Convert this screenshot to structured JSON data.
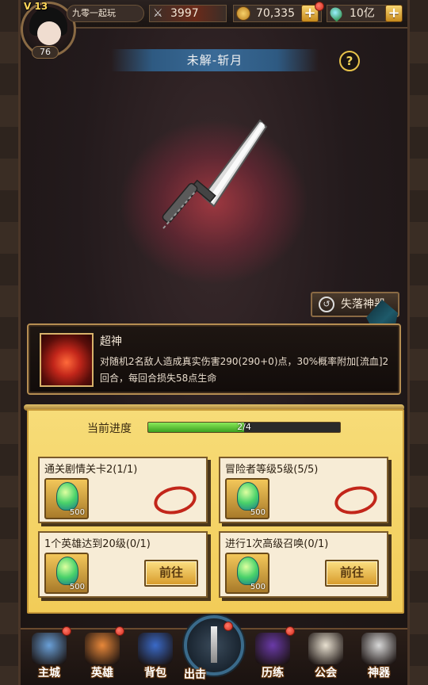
{
  "player": {
    "vip": "V 13",
    "level": "76",
    "name": "九零一起玩"
  },
  "resources": {
    "power": "3997",
    "coins": "70,335",
    "gems": "10亿"
  },
  "page_title": "未解-斩月",
  "help_label": "?",
  "lost_artifact_label": "失落神器",
  "skill": {
    "name": "超神",
    "description": "对随机2名敌人造成真实伤害290(290+0)点，30%概率附加[流血]2回合，每回合损失58点生命"
  },
  "progress": {
    "label": "当前进度",
    "text": "2/4",
    "fraction": 0.5
  },
  "tasks": [
    {
      "title": "通关剧情关卡2(1/1)",
      "reward": "500",
      "status": "done"
    },
    {
      "title": "冒险者等级5级(5/5)",
      "reward": "500",
      "status": "done"
    },
    {
      "title": "1个英雄达到20级(0/1)",
      "reward": "500",
      "status": "go",
      "button": "前往"
    },
    {
      "title": "进行1次高级召唤(0/1)",
      "reward": "500",
      "status": "go",
      "button": "前往"
    }
  ],
  "nav": [
    {
      "label": "主城",
      "badge": true,
      "color": "#6aa0d8"
    },
    {
      "label": "英雄",
      "badge": true,
      "color": "#e8883a"
    },
    {
      "label": "背包",
      "badge": false,
      "color": "#3a6ac8"
    },
    {
      "label": "出击",
      "badge": true,
      "color": "#3a6a8a"
    },
    {
      "label": "历练",
      "badge": true,
      "color": "#6a3aa8"
    },
    {
      "label": "公会",
      "badge": false,
      "color": "#e8e0d0"
    },
    {
      "label": "神器",
      "badge": false,
      "color": "#d8d8d8"
    }
  ]
}
